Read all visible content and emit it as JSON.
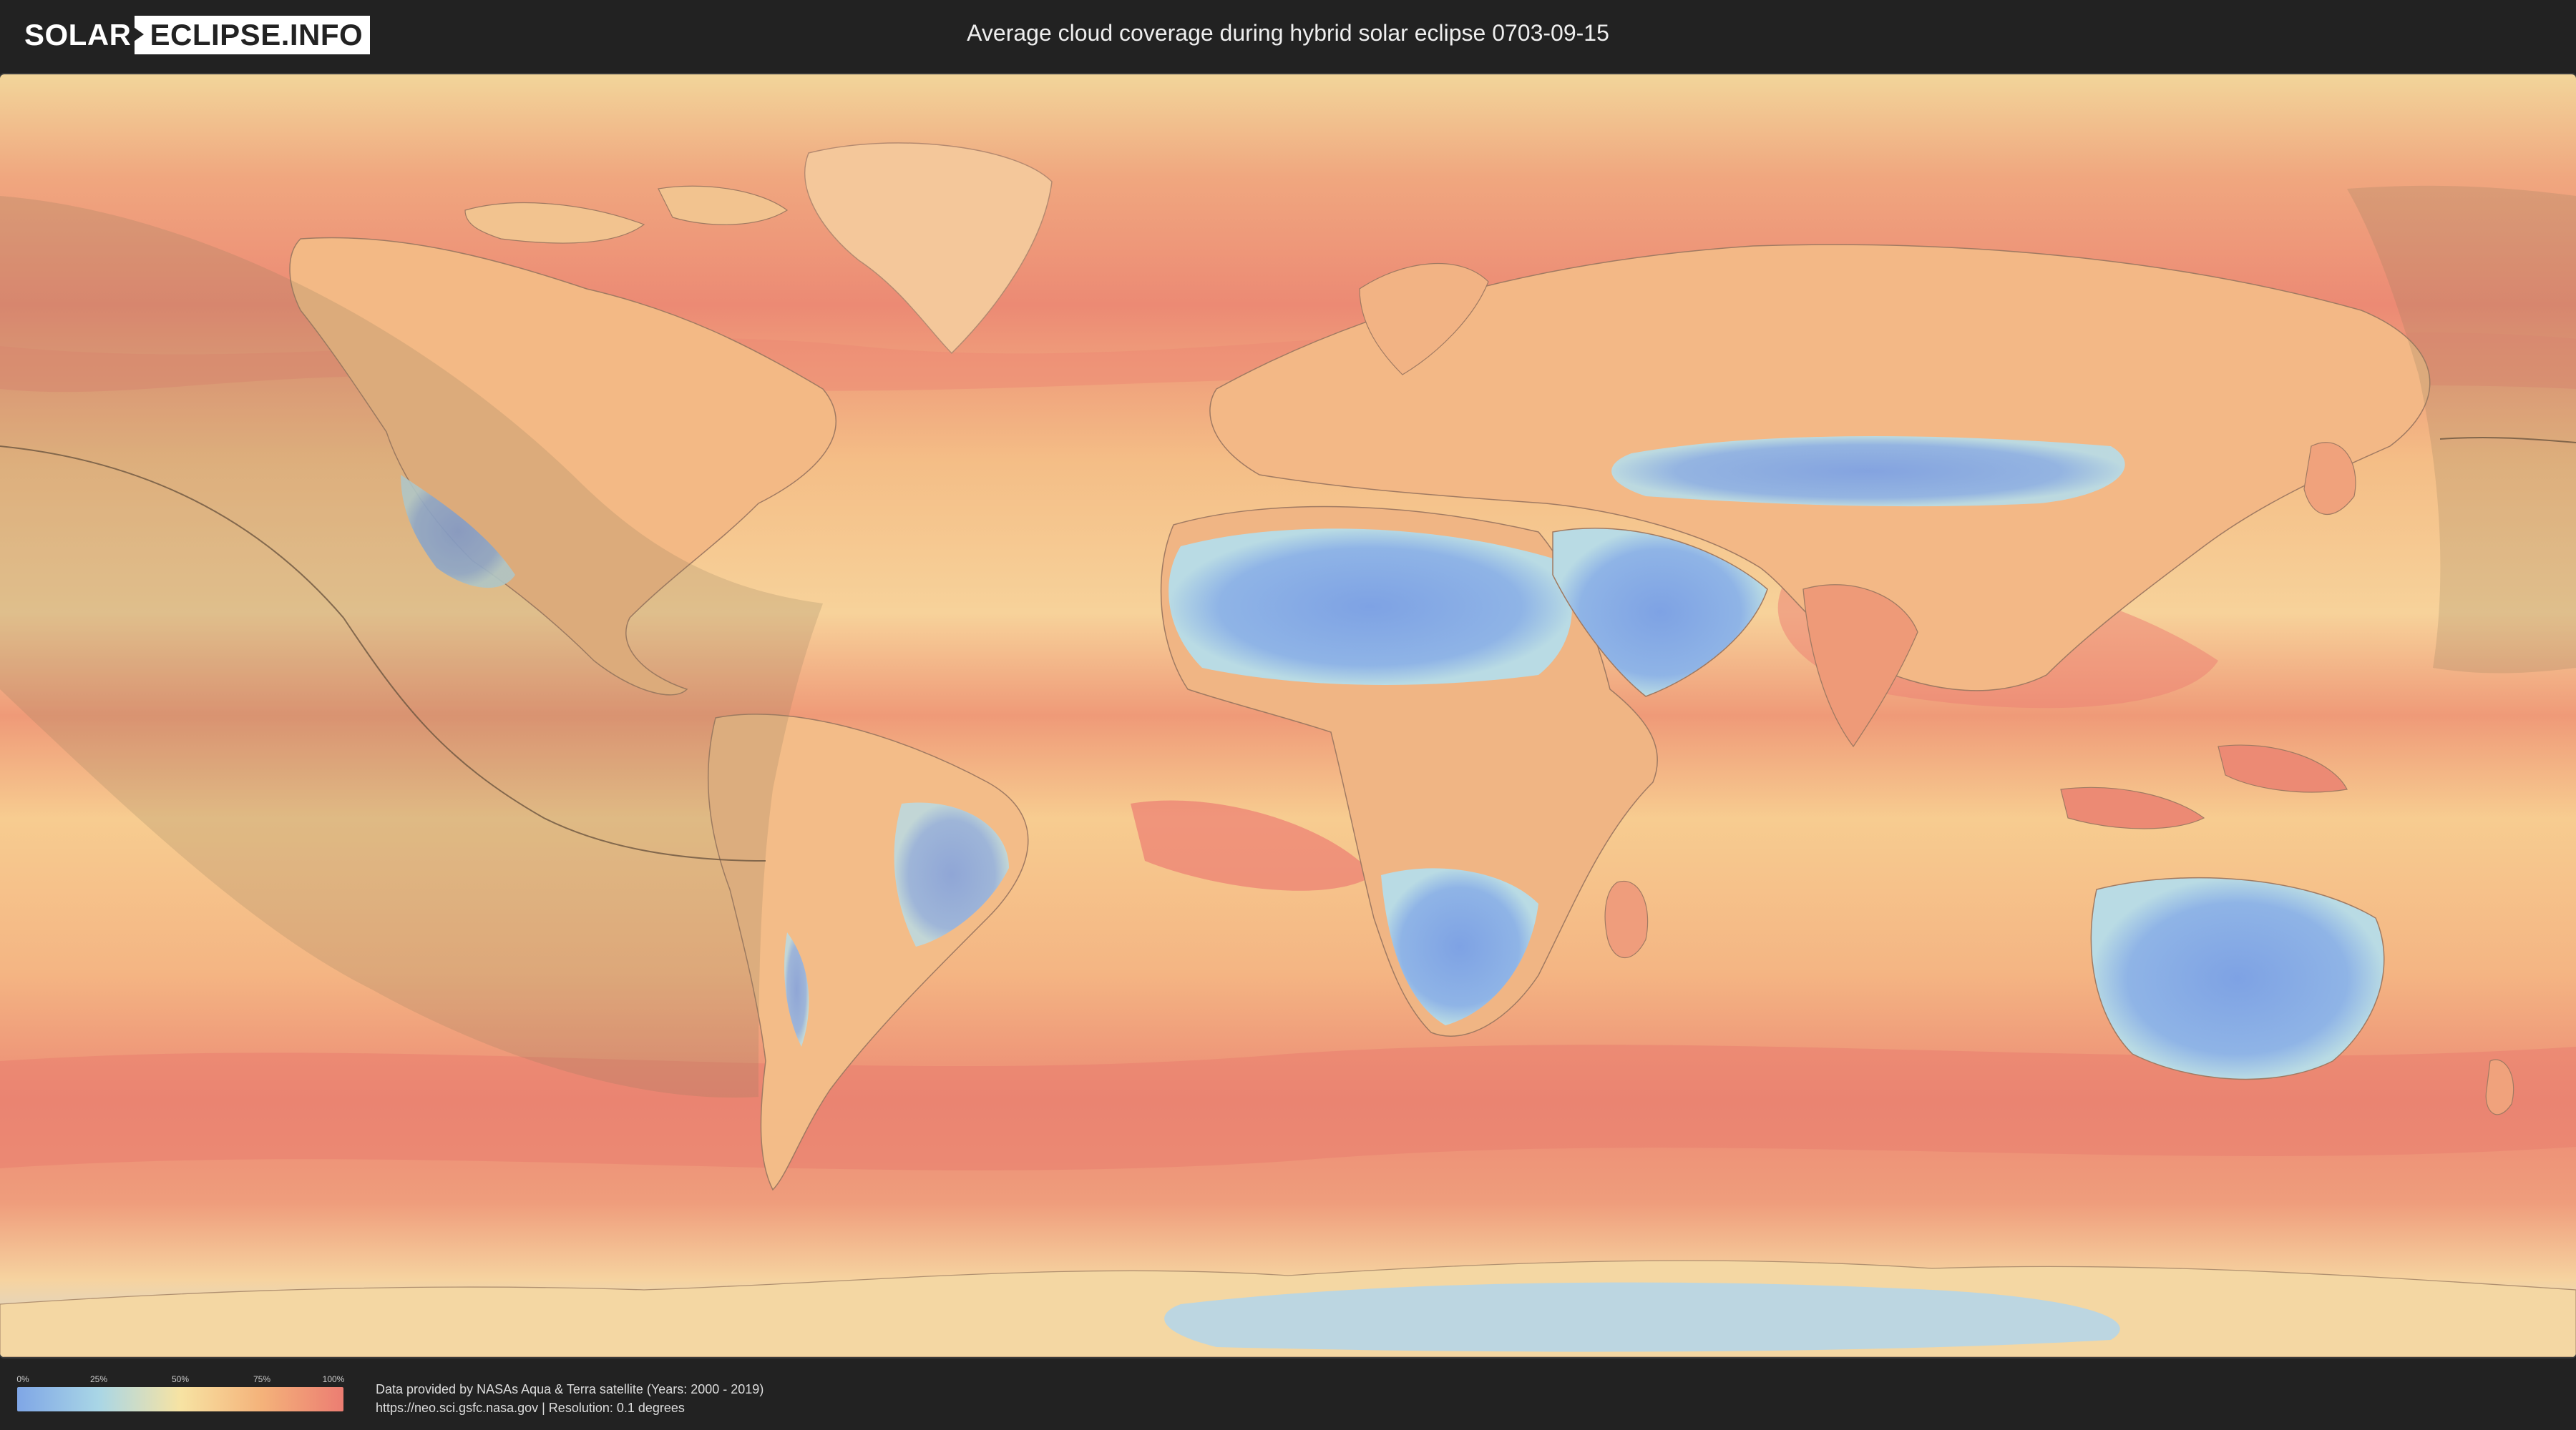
{
  "header": {
    "logo_left": "SOLAR",
    "logo_right": "ECLIPSE.INFO",
    "title": "Average cloud coverage during hybrid solar eclipse 0703-09-15"
  },
  "legend": {
    "ticks": [
      "0%",
      "25%",
      "50%",
      "75%",
      "100%"
    ],
    "colors": [
      "#7fa6e6",
      "#a9d6e6",
      "#f7e3a3",
      "#f4b27a",
      "#ec7d72"
    ]
  },
  "footer": {
    "credit_line1": "Data provided by NASAs Aqua & Terra satellite (Years: 2000 - 2019)",
    "credit_line2": "https://neo.sci.gsfc.nasa.gov | Resolution: 0.1 degrees"
  },
  "map": {
    "ocean_color": "#f6b37f",
    "land_clear_color": "#7fa6e6",
    "cloudy_band_color": "#ec7d72",
    "eclipse_shadow_color": "#8c7a5a"
  }
}
